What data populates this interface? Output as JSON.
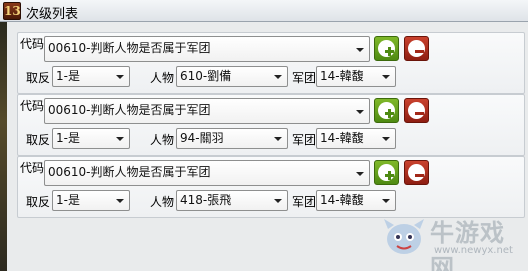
{
  "window": {
    "icon_text": "13",
    "title": "次级列表"
  },
  "labels": {
    "code": "代码",
    "negate": "取反",
    "person": "人物",
    "army": "军团"
  },
  "rows": [
    {
      "code": "00610-判断人物是否属于军团",
      "negate": "1-是",
      "person": "610-劉備",
      "army": "14-韓馥"
    },
    {
      "code": "00610-判断人物是否属于军团",
      "negate": "1-是",
      "person": "94-關羽",
      "army": "14-韓馥"
    },
    {
      "code": "00610-判断人物是否属于军团",
      "negate": "1-是",
      "person": "418-張飛",
      "army": "14-韓馥"
    }
  ],
  "icons": {
    "add": "add-icon",
    "remove": "remove-icon",
    "dropdown": "chevron-down-icon"
  },
  "colors": {
    "add_button": "#5a9a18",
    "remove_button": "#a22818"
  },
  "watermark": {
    "text": "牛游戏网",
    "url": "www.newyx.net"
  }
}
